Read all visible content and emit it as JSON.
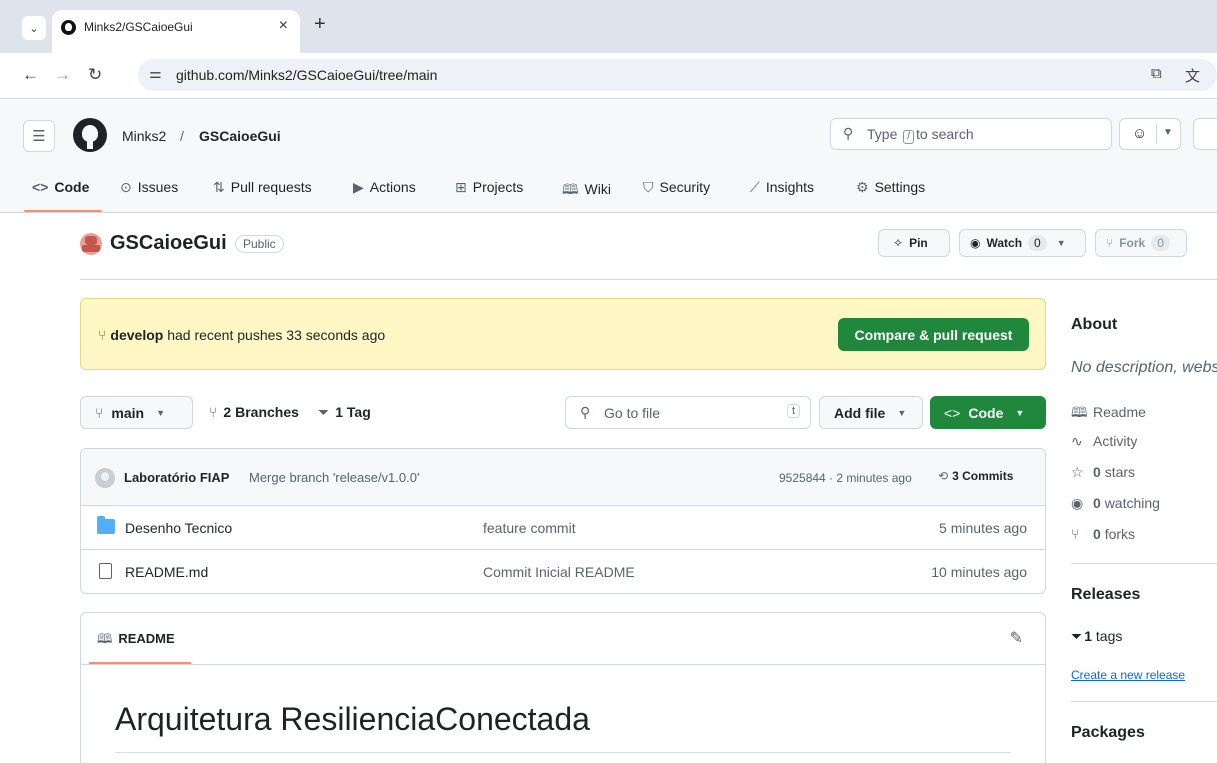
{
  "browser": {
    "tab_title": "Minks2/GSCaioeGui",
    "tab_close": "×",
    "new_tab": "+",
    "url": "github.com/Minks2/GSCaioeGui/tree/main"
  },
  "header": {
    "owner": "Minks2",
    "separator": "/",
    "repo": "GSCaioeGui",
    "search_pre": "Type",
    "search_key": "/",
    "search_post": "to search"
  },
  "repo_nav": {
    "items": [
      {
        "icon": "code-icon",
        "glyph": "<>",
        "label": "Code"
      },
      {
        "icon": "issues-icon",
        "glyph": "⊙",
        "label": "Issues"
      },
      {
        "icon": "pull-request-icon",
        "glyph": "⇅",
        "label": "Pull requests"
      },
      {
        "icon": "actions-icon",
        "glyph": "▶",
        "label": "Actions"
      },
      {
        "icon": "projects-icon",
        "glyph": "⊞",
        "label": "Projects"
      },
      {
        "icon": "wiki-icon",
        "glyph": "🕮",
        "label": "Wiki"
      },
      {
        "icon": "security-icon",
        "glyph": "⛉",
        "label": "Security"
      },
      {
        "icon": "insights-icon",
        "glyph": "⟋",
        "label": "Insights"
      },
      {
        "icon": "settings-icon",
        "glyph": "⚙",
        "label": "Settings"
      }
    ]
  },
  "repo": {
    "name": "GSCaioeGui",
    "visibility": "Public",
    "pin_label": "Pin",
    "watch_label": "Watch",
    "watch_count": "0",
    "fork_label": "Fork",
    "fork_count": "0"
  },
  "banner": {
    "branch": "develop",
    "text": "had recent pushes 33 seconds ago",
    "button": "Compare & pull request"
  },
  "controls": {
    "branch": "main",
    "branches_count": "2",
    "branches_label": "Branches",
    "tags_count": "1",
    "tags_label": "Tag",
    "goto_placeholder": "Go to file",
    "goto_key": "t",
    "add_file": "Add file",
    "code": "Code"
  },
  "commit": {
    "author": "Laboratório FIAP",
    "message": "Merge branch 'release/v1.0.0'",
    "meta": "9525844 · 2 minutes ago",
    "count": "3 Commits"
  },
  "files": [
    {
      "type": "folder",
      "name": "Desenho Tecnico",
      "commit": "feature commit",
      "date": "5 minutes ago"
    },
    {
      "type": "file",
      "name": "README.md",
      "commit": "Commit Inicial README",
      "date": "10 minutes ago"
    }
  ],
  "readme": {
    "tab": "README",
    "heading": "Arquitetura ResilienciaConectada"
  },
  "sidebar": {
    "about_title": "About",
    "description": "No description, website, or topics provided.",
    "readme": "Readme",
    "activity": "Activity",
    "stars_count": "0",
    "stars_label": "stars",
    "watching_count": "0",
    "watching_label": "watching",
    "forks_count": "0",
    "forks_label": "forks",
    "releases_title": "Releases",
    "tags_count": "1",
    "tags_label": "tags",
    "create_release": "Create a new release",
    "packages_title": "Packages"
  },
  "colors": {
    "accent_green": "#1f883d",
    "banner_bg": "#fff8c5",
    "tab_underline": "#fd8c73",
    "link_blue": "#0969da"
  }
}
